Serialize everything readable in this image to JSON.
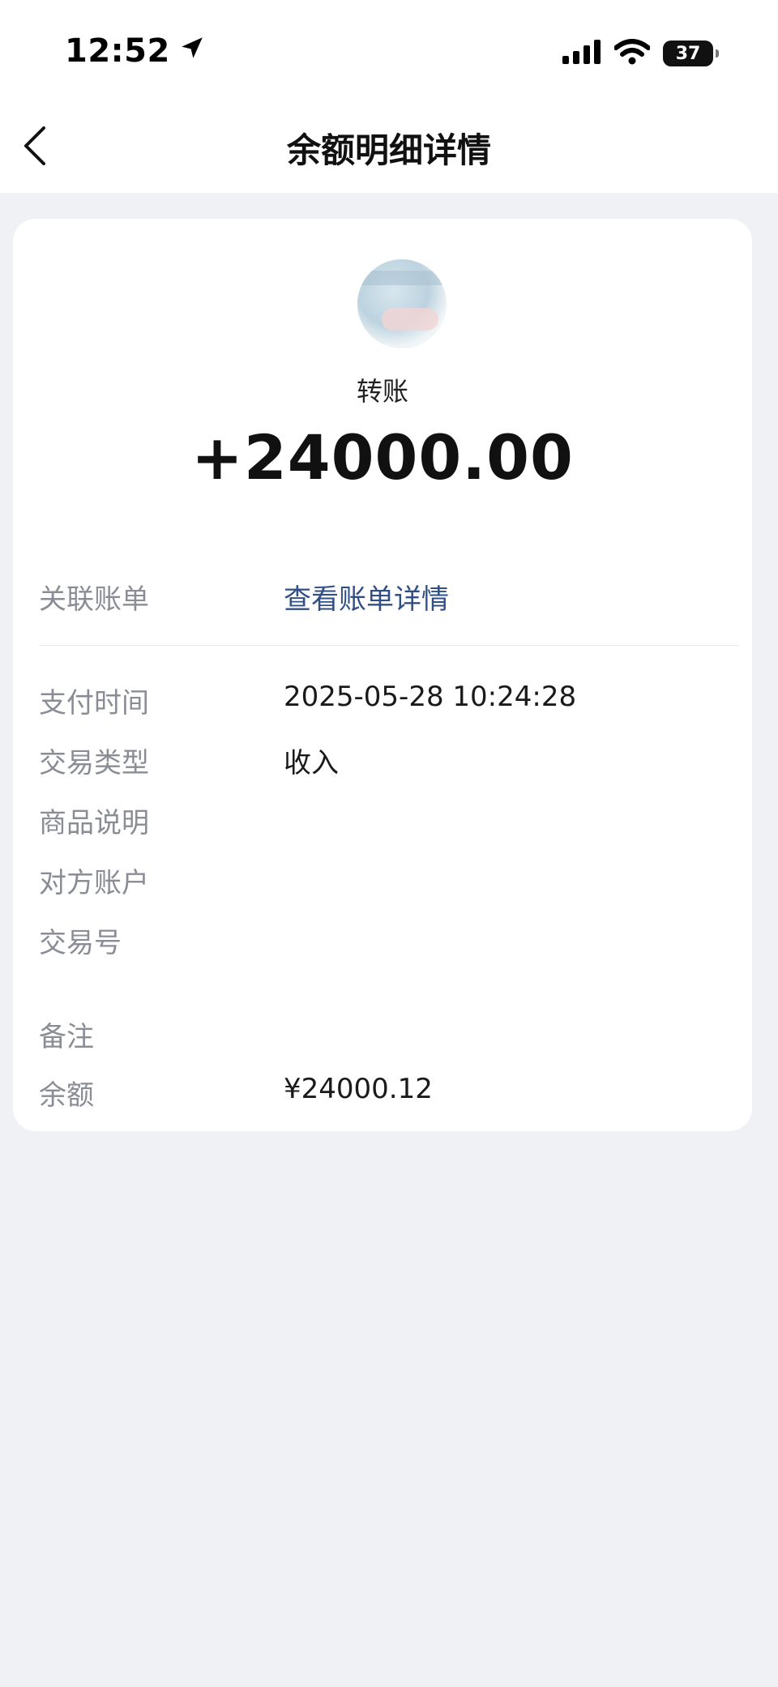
{
  "status_bar": {
    "time": "12:52",
    "battery": "37"
  },
  "nav": {
    "title": "余额明细详情"
  },
  "summary": {
    "counterparty": "转账",
    "amount": "+24000.00"
  },
  "link_row": {
    "label": "关联账单",
    "value": "查看账单详情"
  },
  "details": [
    {
      "label": "支付时间",
      "value": "2025-05-28 10:24:28"
    },
    {
      "label": "交易类型",
      "value": "收入"
    },
    {
      "label": "商品说明",
      "value": ""
    },
    {
      "label": "对方账户",
      "value": ""
    },
    {
      "label": "交易号",
      "value": ""
    },
    {
      "label": "备注",
      "value": ""
    },
    {
      "label": "余额",
      "value": "¥24000.12"
    }
  ],
  "colors": {
    "link": "#2f4f86",
    "label": "#8a8d96",
    "background": "#f0f1f5"
  },
  "icons": [
    "location-arrow-icon",
    "cellular-signal-icon",
    "wifi-icon",
    "battery-icon",
    "back-chevron-icon"
  ]
}
